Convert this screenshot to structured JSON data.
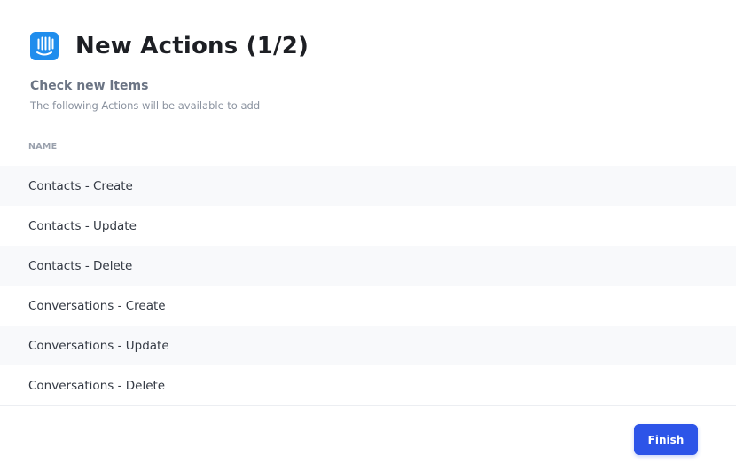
{
  "header": {
    "logo_icon": "intercom-logo-icon",
    "title": "New Actions (1/2)"
  },
  "intro": {
    "heading": "Check new items",
    "description": "The following Actions will be available to add"
  },
  "table": {
    "column_header": "NAME",
    "rows": [
      "Contacts - Create",
      "Contacts - Update",
      "Contacts - Delete",
      "Conversations - Create",
      "Conversations - Update",
      "Conversations - Delete"
    ]
  },
  "footer": {
    "finish_label": "Finish"
  },
  "colors": {
    "logo": "#1f8ded",
    "primary_button": "#2d54e8",
    "striped_row": "#f8f9fb"
  }
}
